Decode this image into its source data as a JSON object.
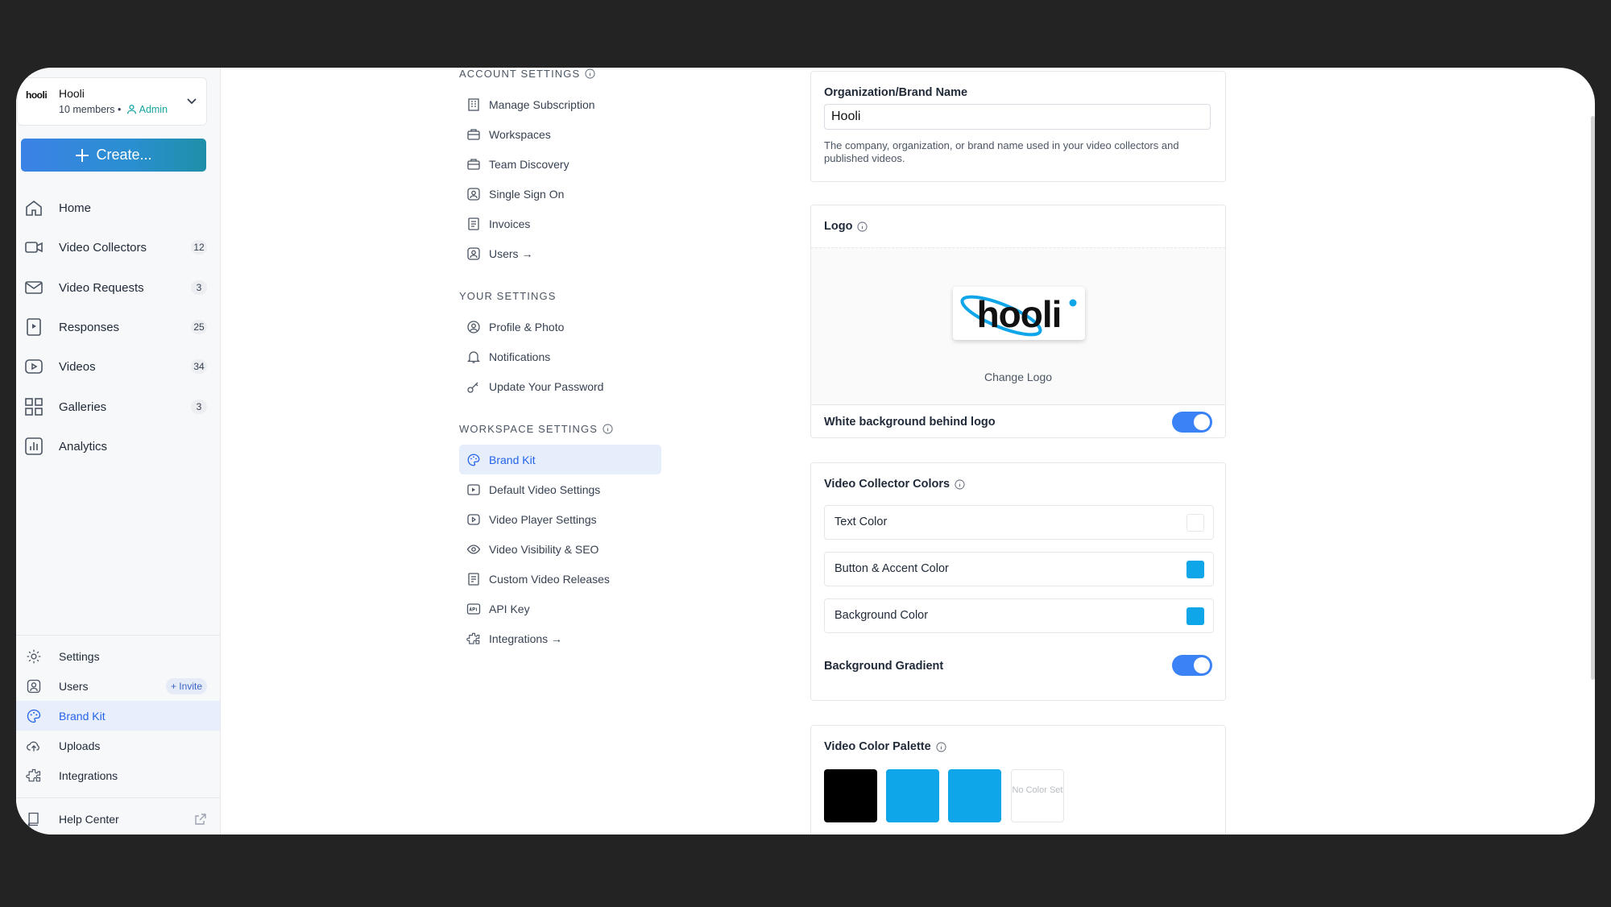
{
  "workspace": {
    "logo_text": "hooli",
    "name": "Hooli",
    "members": "10 members •",
    "role": "Admin"
  },
  "create_label": "Create...",
  "main_nav": [
    {
      "label": "Home",
      "icon": "home-icon",
      "count": ""
    },
    {
      "label": "Video Collectors",
      "icon": "video-camera-icon",
      "count": "12"
    },
    {
      "label": "Video Requests",
      "icon": "envelope-icon",
      "count": "3"
    },
    {
      "label": "Responses",
      "icon": "responses-icon",
      "count": "25"
    },
    {
      "label": "Videos",
      "icon": "play-icon",
      "count": "34"
    },
    {
      "label": "Galleries",
      "icon": "grid-icon",
      "count": "3"
    },
    {
      "label": "Analytics",
      "icon": "chart-icon",
      "count": ""
    }
  ],
  "bottom_nav": {
    "settings": "Settings",
    "users": "Users",
    "invite": "+ Invite",
    "brand_kit": "Brand Kit",
    "uploads": "Uploads",
    "integrations": "Integrations",
    "help_center": "Help Center"
  },
  "settings_menu": {
    "account_title": "ACCOUNT SETTINGS",
    "account_items": [
      "Manage Subscription",
      "Workspaces",
      "Team Discovery",
      "Single Sign On",
      "Invoices",
      "Users →"
    ],
    "your_title": "YOUR SETTINGS",
    "your_items": [
      "Profile & Photo",
      "Notifications",
      "Update Your Password"
    ],
    "workspace_title": "WORKSPACE SETTINGS",
    "workspace_items": [
      "Brand Kit",
      "Default Video Settings",
      "Video Player Settings",
      "Video Visibility & SEO",
      "Custom Video Releases",
      "API Key",
      "Integrations →"
    ]
  },
  "brand": {
    "org_label": "Organization/Brand Name",
    "org_value": "Hooli",
    "org_help": "The company, organization, or brand name used in your video collectors and published videos.",
    "logo_label": "Logo",
    "logo_text": "hooli",
    "change_logo": "Change Logo",
    "white_bg_label": "White background behind logo",
    "white_bg_on": true,
    "collector_colors_label": "Video Collector Colors",
    "text_color_label": "Text Color",
    "text_color": "#ffffff",
    "accent_color_label": "Button & Accent Color",
    "accent_color": "#0ea5e9",
    "bg_color_label": "Background Color",
    "bg_color": "#0ea5e9",
    "gradient_label": "Background Gradient",
    "gradient_on": true,
    "palette_label": "Video Color Palette",
    "palette": [
      "#000000",
      "#0ea5e9",
      "#0ea5e9"
    ],
    "no_color_label": "No Color Set"
  },
  "colors": {
    "accent": "#2563eb",
    "toggle": "#3b82f6",
    "admin": "#16a3a0"
  }
}
